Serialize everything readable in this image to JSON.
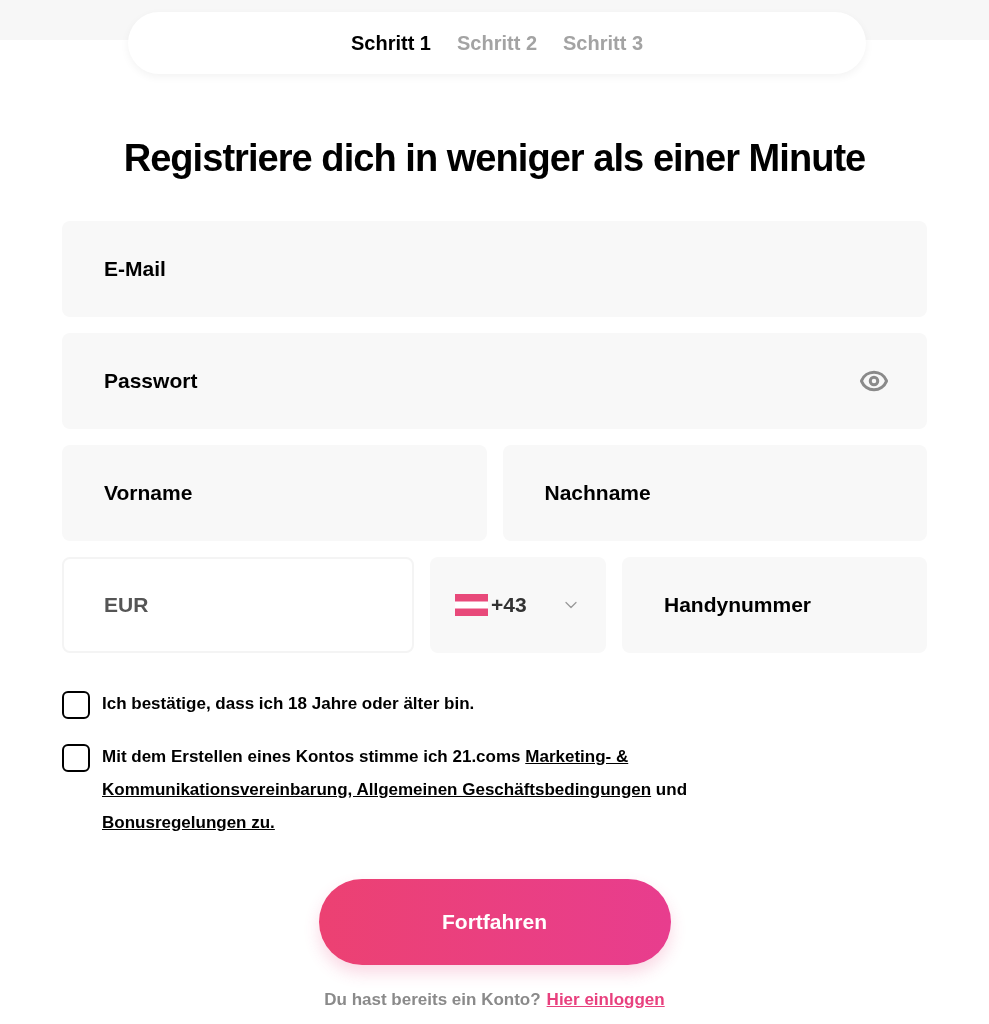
{
  "steps": [
    {
      "label": "Schritt 1",
      "selected": true
    },
    {
      "label": "Schritt 2",
      "selected": false
    },
    {
      "label": "Schritt 3",
      "selected": false
    }
  ],
  "heading": "Registriere dich in weniger als einer Minute",
  "fields": {
    "email": {
      "placeholder": "E-Mail"
    },
    "password": {
      "placeholder": "Passwort"
    },
    "first_name": {
      "placeholder": "Vorname"
    },
    "last_name": {
      "placeholder": "Nachname"
    },
    "currency": {
      "value": "EUR",
      "disabled": true
    },
    "country_code": {
      "value": "+43"
    },
    "phone": {
      "placeholder": "Handynummer"
    }
  },
  "consents": [
    {
      "checked": false,
      "segments": [
        {
          "text": "Ich bestätige, dass ich 18 Jahre oder älter bin.",
          "kind": "text"
        }
      ]
    },
    {
      "checked": false,
      "segments": [
        {
          "text": "Mit dem Erstellen eines Kontos stimme ich 21.coms",
          "kind": "text"
        },
        {
          "text": "Marketing- &",
          "kind": "link"
        },
        {
          "text": "Kommunikationsvereinbarung, Allgemeinen Geschäftsbedingungen",
          "kind": "link"
        },
        {
          "text": "und",
          "kind": "text"
        },
        {
          "text": "Bonusregelungen zu.",
          "kind": "link"
        }
      ]
    }
  ],
  "submit": "Fortfahren",
  "login_prompt": {
    "text": "Du hast bereits ein Konto?",
    "link": "Hier einloggen"
  }
}
